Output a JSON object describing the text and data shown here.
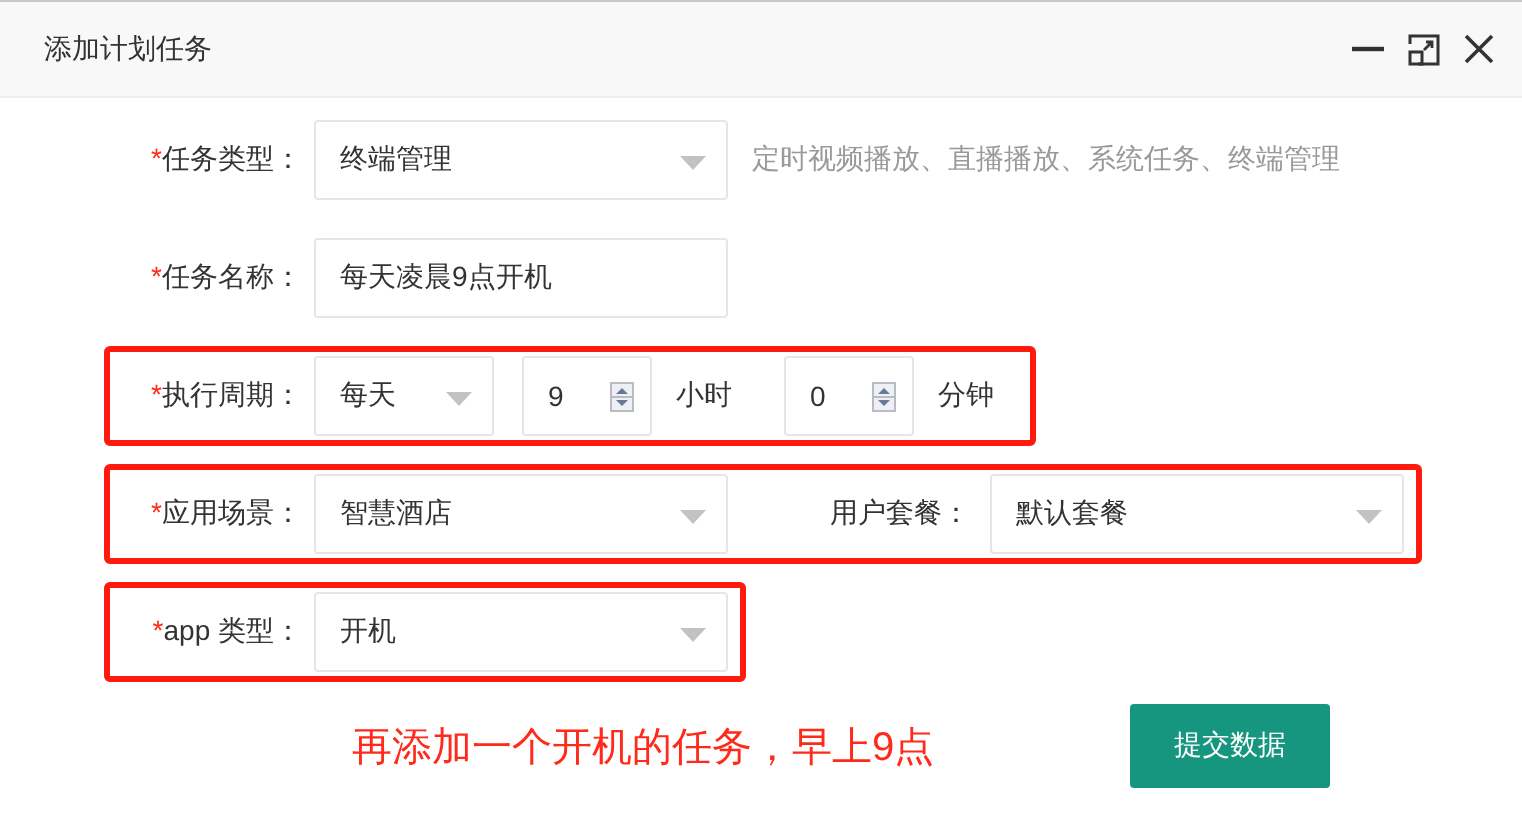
{
  "window": {
    "title": "添加计划任务"
  },
  "rows": [
    {
      "required_mark": "*",
      "label": "任务类型：",
      "highlighted": false,
      "controls": [
        {
          "kind": "select",
          "value": "终端管理"
        },
        {
          "kind": "hint",
          "text": "定时视频播放、直播播放、系统任务、终端管理"
        }
      ]
    },
    {
      "required_mark": "*",
      "label": "任务名称：",
      "highlighted": false,
      "controls": [
        {
          "kind": "input",
          "value": "每天凌晨9点开机"
        }
      ]
    },
    {
      "required_mark": "*",
      "label": "执行周期：",
      "highlighted": true,
      "controls": [
        {
          "kind": "select",
          "value": "每天"
        },
        {
          "kind": "number",
          "value": "9"
        },
        {
          "kind": "unit",
          "text": "小时"
        },
        {
          "kind": "number",
          "value": "0"
        },
        {
          "kind": "unit",
          "text": "分钟"
        }
      ]
    },
    {
      "required_mark": "*",
      "label": "应用场景：",
      "highlighted": true,
      "controls": [
        {
          "kind": "select",
          "value": "智慧酒店"
        },
        {
          "kind": "label",
          "text": "用户套餐："
        },
        {
          "kind": "select",
          "value": "默认套餐"
        }
      ]
    },
    {
      "required_mark": "*",
      "label": "app 类型：",
      "highlighted": true,
      "controls": [
        {
          "kind": "select",
          "value": "开机"
        }
      ]
    }
  ],
  "annotation": "再添加一个开机的任务，早上9点",
  "submit_button": "提交数据"
}
